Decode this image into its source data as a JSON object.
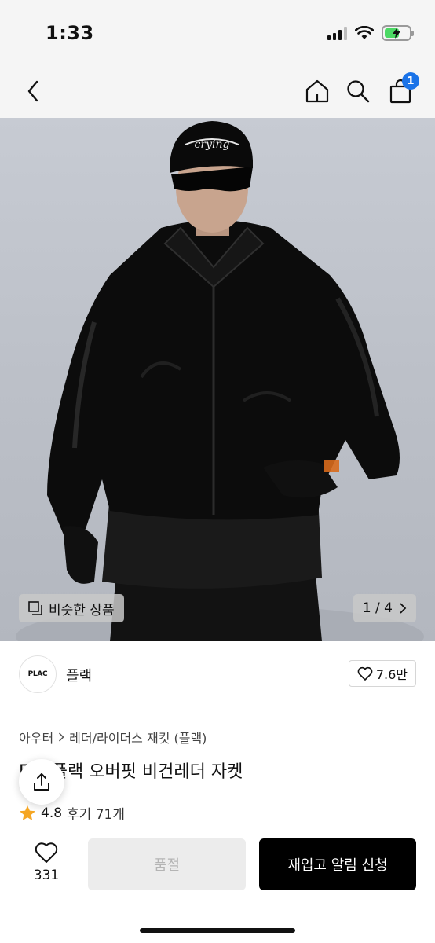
{
  "status_bar": {
    "time": "1:33"
  },
  "nav": {
    "icons": [
      "back-icon",
      "home-icon",
      "search-icon",
      "cart-icon"
    ],
    "cart_count": "1",
    "accent_color": "#1a73e8"
  },
  "hero": {
    "similar_label": "비슷한 상품",
    "pager": "1 / 4",
    "cap_text": "crying"
  },
  "brand": {
    "logo_text": "PLAC",
    "name": "플랙",
    "likes": "7.6만"
  },
  "product": {
    "breadcrumb": [
      "아우터",
      "레더/라이더스 재킷 (플랙)"
    ],
    "title": "F     X 플랙 오버핏 비건레더 자켓",
    "rating": "4.8",
    "review_label": "후기 71개"
  },
  "bottom": {
    "wish_count": "331",
    "soldout_label": "품절",
    "restock_label": "재입고 알림 신청"
  }
}
